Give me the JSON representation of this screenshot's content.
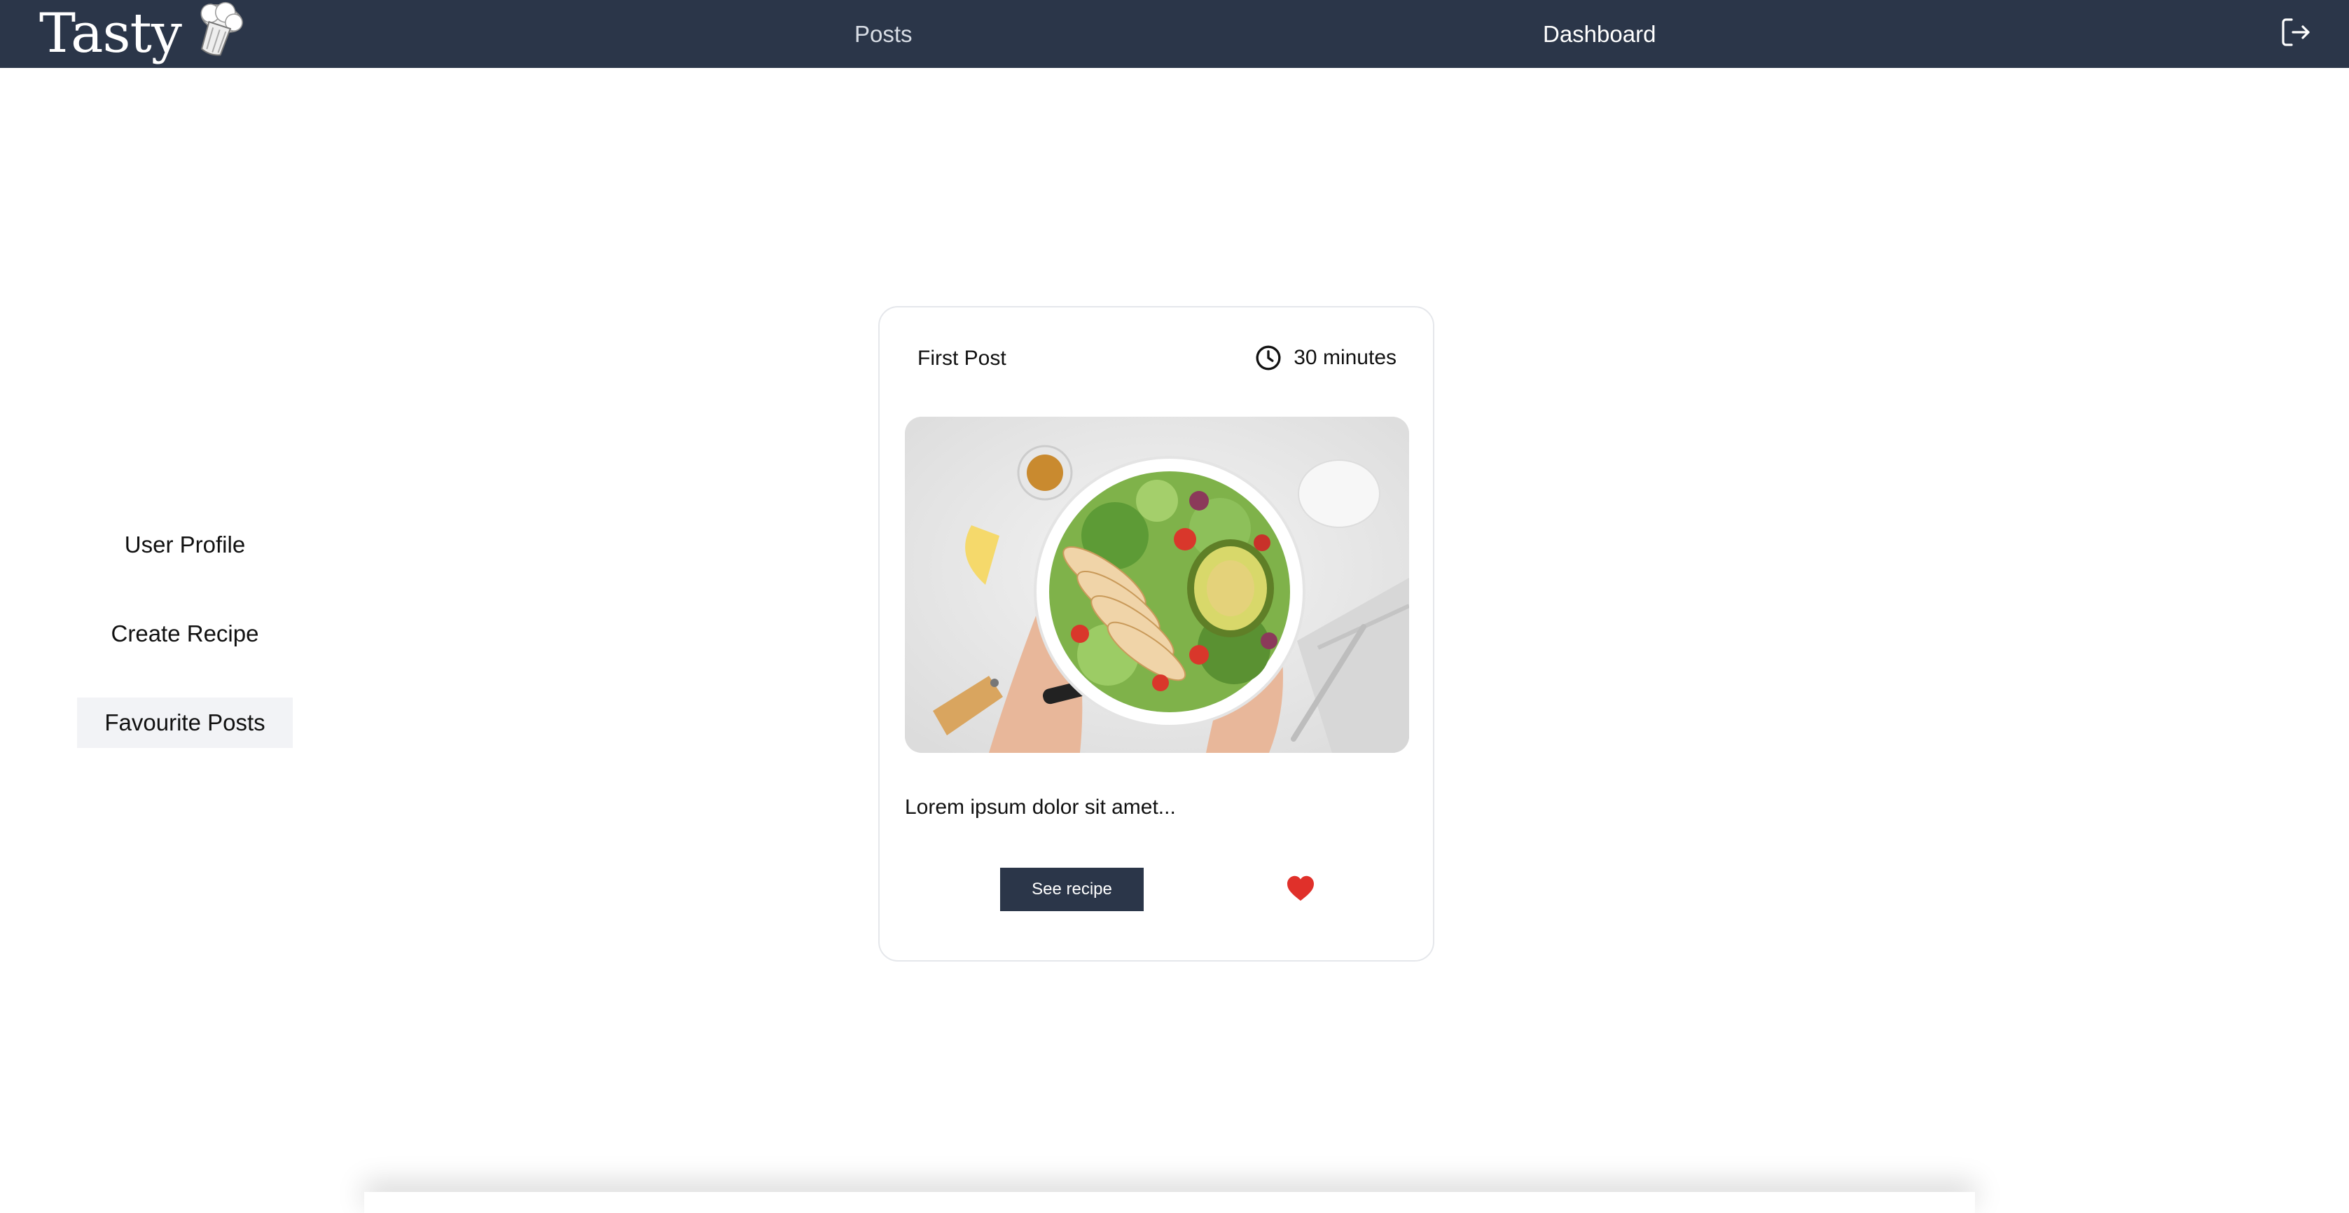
{
  "navbar": {
    "brand": "Tasty",
    "links": [
      "Posts",
      "Dashboard"
    ],
    "logo_icon": "chef-hat-icon",
    "logout_icon": "logout-icon",
    "background": "#2b3649"
  },
  "sidebar": {
    "items": [
      {
        "label": "User Profile",
        "active": false
      },
      {
        "label": "Create Recipe",
        "active": false
      },
      {
        "label": "Favourite Posts",
        "active": true
      }
    ]
  },
  "post": {
    "title": "First Post",
    "time_icon": "clock-icon",
    "time": "30 minutes",
    "image_icon": "salad-bowl-image",
    "description": "Lorem ipsum dolor sit amet...",
    "button_label": "See recipe",
    "favourite_icon": "heart-icon",
    "favourited": true,
    "heart_color": "#e0302a"
  }
}
